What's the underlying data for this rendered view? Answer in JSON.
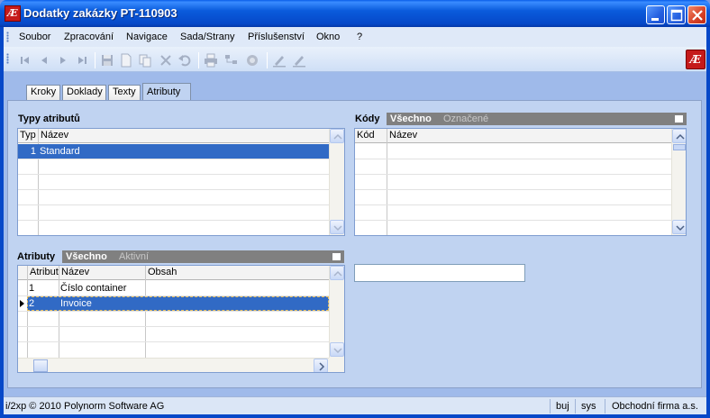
{
  "window": {
    "icon_text": "Æ",
    "title": "Dodatky zakázky  PT-110903"
  },
  "menu": [
    "Soubor",
    "Zpracování",
    "Navigace",
    "Sada/Strany",
    "Příslušenství",
    "Okno",
    "?"
  ],
  "toolbar": {
    "icons": [
      "first-record-icon",
      "prev-record-icon",
      "next-record-icon",
      "last-record-icon",
      "save-icon",
      "new-document-icon",
      "copy-icon",
      "delete-icon",
      "undo-icon",
      "print-icon",
      "tree-icon",
      "record-icon",
      "edit-pen-icon",
      "highlight-pen-icon"
    ],
    "logo_text": "Æ"
  },
  "tabs": [
    "Kroky",
    "Doklady",
    "Texty",
    "Atributy"
  ],
  "active_tab": "Atributy",
  "attr_types": {
    "label": "Typy atributů",
    "columns": [
      "Typ",
      "Název"
    ],
    "rows": [
      {
        "typ": "1",
        "nazev": "Standard"
      }
    ]
  },
  "codes": {
    "label": "Kódy",
    "filter_all": "Všechno",
    "filter_marked": "Označené",
    "columns": [
      "Kód",
      "Název"
    ]
  },
  "attributes": {
    "label": "Atributy",
    "filter_all": "Všechno",
    "filter_active": "Aktivní",
    "columns": [
      "Atribut",
      "Název",
      "Obsah"
    ],
    "rows": [
      {
        "atribut": "1",
        "nazev": "Číslo container",
        "obsah": ""
      },
      {
        "atribut": "2",
        "nazev": "Invoice",
        "obsah": ""
      }
    ]
  },
  "value_input": "",
  "status": {
    "copyright": "i/2xp © 2010 Polynorm Software AG",
    "user": "buj",
    "system": "sys",
    "company": "Obchodní firma a.s."
  },
  "colors": {
    "title_bar": "#0a5bdc",
    "selection": "#316ac5",
    "panel": "#c0d3f1",
    "logo": "#c51a1a"
  }
}
